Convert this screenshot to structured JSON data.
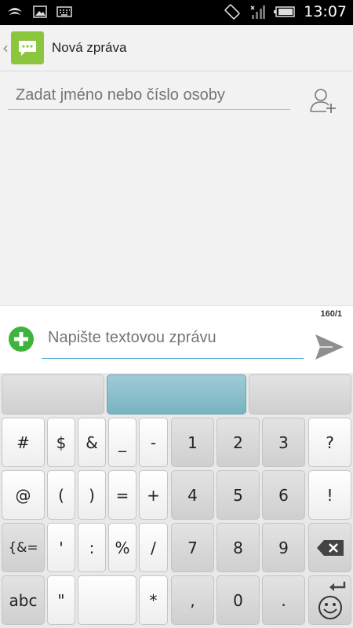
{
  "status_bar": {
    "time": "13:07"
  },
  "action_bar": {
    "title": "Nová zpráva",
    "back_icon": "chevron-left-icon",
    "app_icon": "sms-bubble-icon"
  },
  "recipient": {
    "placeholder": "Zadat jméno nebo číslo osoby",
    "add_icon": "add-person-icon"
  },
  "compose": {
    "counter": "160/1",
    "placeholder": "Napište textovou zprávu",
    "attach_icon": "plus-circle-icon",
    "send_icon": "send-icon"
  },
  "keyboard": {
    "row1": [
      "#",
      "$",
      "&",
      "_",
      "-",
      "1",
      "2",
      "3",
      "?"
    ],
    "row2": [
      "@",
      "(",
      ")",
      "=",
      "+",
      "4",
      "5",
      "6",
      "!"
    ],
    "row3": [
      "{&=",
      "'",
      ":",
      "%",
      "/",
      "7",
      "8",
      "9"
    ],
    "row4": [
      "abc",
      "\"",
      "*",
      ",",
      "0",
      "."
    ],
    "backspace_icon": "backspace-icon",
    "emoji_icon": "smiley-icon",
    "enter_icon": "enter-arrow-icon"
  },
  "colors": {
    "accent": "#3aa7c9",
    "app_icon_bg": "#8cc63f",
    "attach_green": "#3eb43e",
    "send_gray": "#8f8f8f"
  }
}
